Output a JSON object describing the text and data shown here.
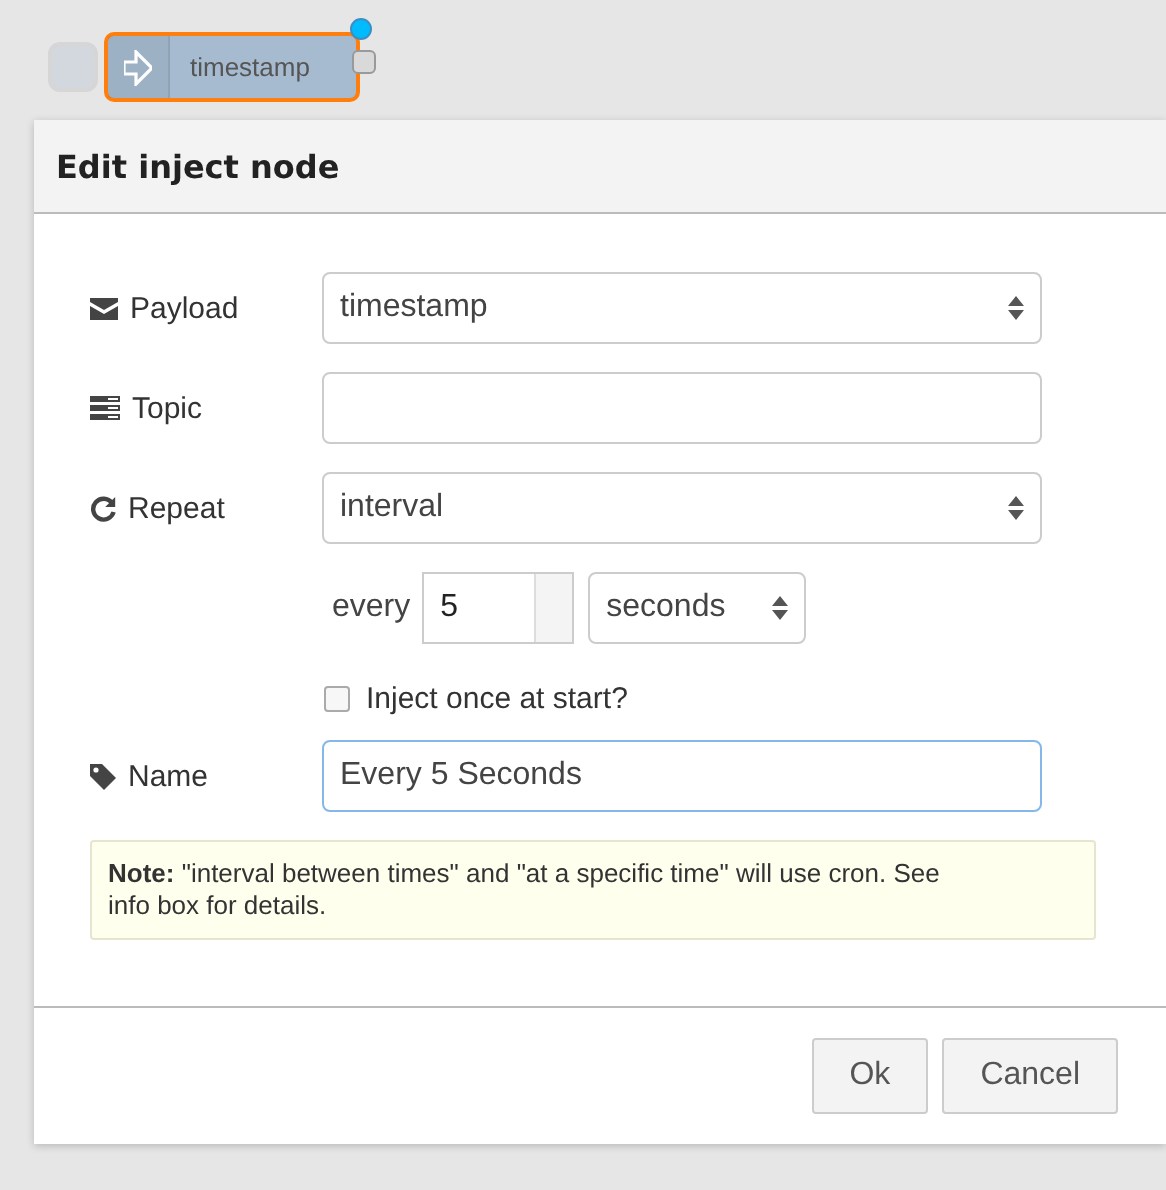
{
  "node": {
    "label": "timestamp",
    "selected": true,
    "changed": true
  },
  "dialog": {
    "title": "Edit inject node",
    "rows": [
      {
        "kind": "select",
        "label": "Payload",
        "value": "timestamp"
      },
      {
        "kind": "text",
        "label": "Topic"
      },
      {
        "kind": "select",
        "label": "Repeat",
        "value": "interval"
      }
    ],
    "interval": {
      "label": "every",
      "value": "5",
      "unit": "seconds"
    },
    "checkbox": {
      "label": "Inject once at start?",
      "checked": false
    },
    "name": {
      "label": "Name",
      "value": "Every 5 Seconds",
      "focused": true
    },
    "note": "**Note:** \"interval between times\" and \"at a specific time\" will use cron. See info box for details.",
    "buttons": [
      {
        "label": "Ok"
      },
      {
        "label": "Cancel"
      }
    ]
  }
}
